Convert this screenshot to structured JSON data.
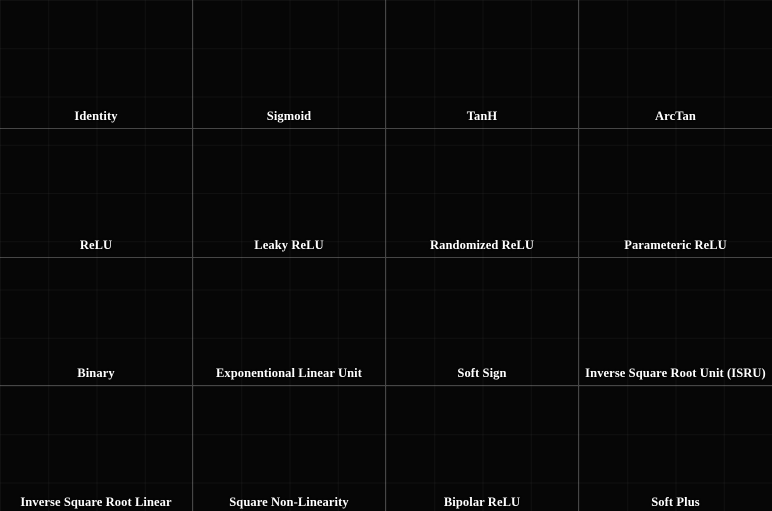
{
  "grid": {
    "rows": 4,
    "cols": 4,
    "cells": [
      {
        "label": "Identity"
      },
      {
        "label": "Sigmoid"
      },
      {
        "label": "TanH"
      },
      {
        "label": "ArcTan"
      },
      {
        "label": "ReLU"
      },
      {
        "label": "Leaky ReLU"
      },
      {
        "label": "Randomized ReLU"
      },
      {
        "label": "Parameteric ReLU"
      },
      {
        "label": "Binary"
      },
      {
        "label": "Exponentional Linear Unit"
      },
      {
        "label": "Soft Sign"
      },
      {
        "label": "Inverse Square Root Unit (ISRU)"
      },
      {
        "label": "Inverse Square Root Linear"
      },
      {
        "label": "Square Non-Linearity"
      },
      {
        "label": "Bipolar ReLU"
      },
      {
        "label": "Soft Plus"
      }
    ]
  }
}
